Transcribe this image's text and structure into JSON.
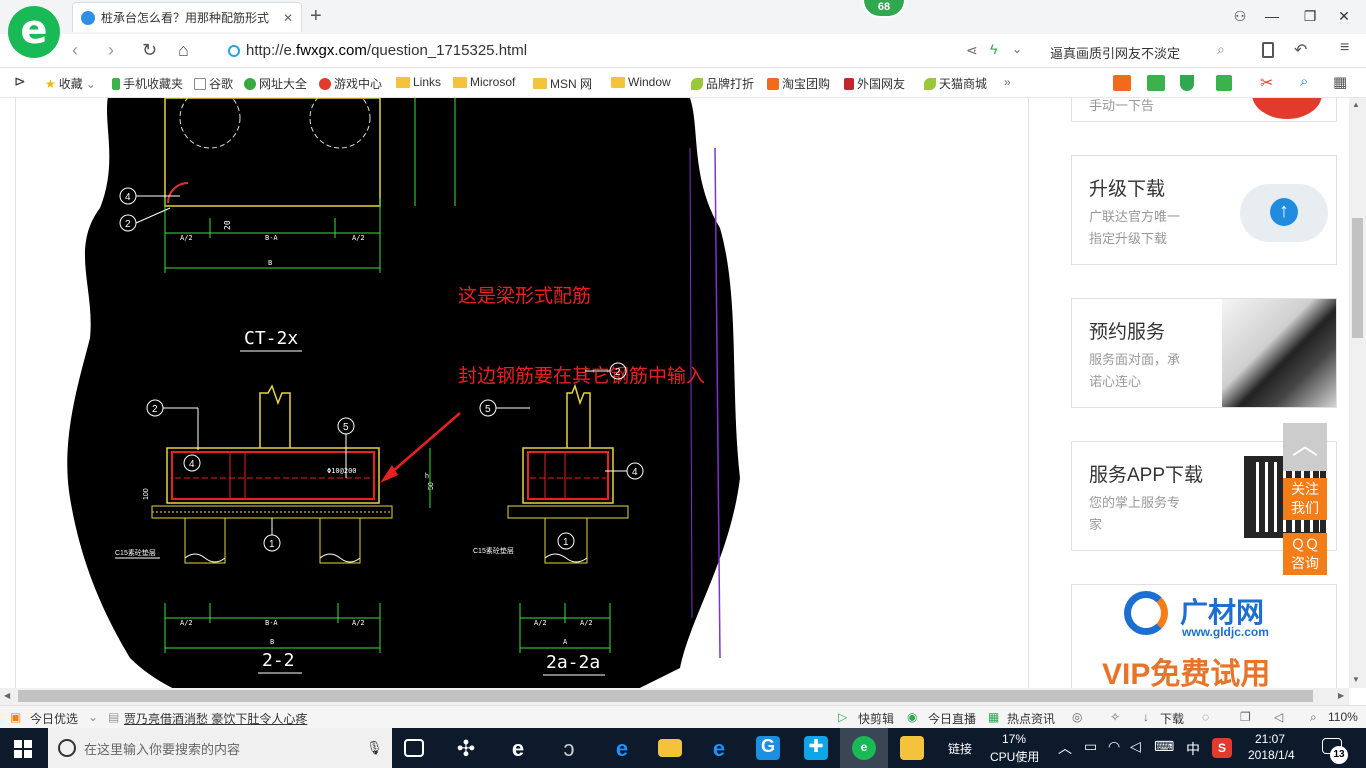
{
  "browser": {
    "badge_count": "68",
    "tab_title": "桩承台怎么看？用那种配筋形式",
    "url_prefix": "http://e.",
    "url_domain": "fwxgx.com",
    "url_path": "/question_1715325.html",
    "search_text": "逼真画质引网友不淡定"
  },
  "bookmarks": [
    {
      "label": "收藏",
      "type": "star"
    },
    {
      "label": "手机收藏夹",
      "type": "phone"
    },
    {
      "label": "谷歌",
      "type": "page"
    },
    {
      "label": "网址大全",
      "type": "site"
    },
    {
      "label": "游戏中心",
      "type": "game"
    },
    {
      "label": "Links",
      "type": "folder"
    },
    {
      "label": "Microsof",
      "type": "folder"
    },
    {
      "label": "MSN 网",
      "type": "folder"
    },
    {
      "label": "Window",
      "type": "folder"
    },
    {
      "label": "品牌打折",
      "type": "leaf"
    },
    {
      "label": "淘宝团购",
      "type": "taobao"
    },
    {
      "label": "外国网友",
      "type": "red"
    },
    {
      "label": "天猫商城",
      "type": "leaf"
    }
  ],
  "cad": {
    "annotation1": "这是梁形式配筋",
    "annotation2": "封边钢筋要在其它钢筋中输入",
    "view1": "CT-2x",
    "view2": "2-2",
    "view3": "2a-2a",
    "rebar_label": "Φ10@200",
    "cushion_left": "C15素砼垫层",
    "cushion_right": "C15素砼垫层",
    "dim_a2": "A/2",
    "dim_ba": "B-A",
    "dim_b": "B",
    "dim_a": "A",
    "dim_20": "20",
    "dim_100": "100",
    "dim_50": "50",
    "dim_h": "h",
    "callouts_left": [
      "2",
      "4",
      "5",
      "1"
    ],
    "callouts_right": [
      "5",
      "2",
      "4",
      "1"
    ],
    "callouts_top": [
      "4",
      "2"
    ]
  },
  "sidebar": {
    "top_partial": "手动一下告",
    "upgrade_title": "升级下载",
    "upgrade_sub1": "广联达官方唯一",
    "upgrade_sub2": "指定升级下载",
    "booking_title": "预约服务",
    "booking_sub1": "服务面对面，承",
    "booking_sub2": "诺心连心",
    "app_title": "服务APP下载",
    "app_sub1": "您的掌上服务专",
    "app_sub2": "家",
    "brand": "广材网",
    "brand_url": "www.gldjc.com",
    "vip": "VIP免费试用"
  },
  "float": {
    "follow1": "关注",
    "follow2": "我们",
    "qq1": "ＱＱ",
    "qq2": "咨询"
  },
  "statusbar": {
    "today": "今日优选",
    "news": "贾乃亮借酒消愁 豪饮下肚令人心疼",
    "quick": "快剪辑",
    "live": "今日直播",
    "hot": "热点资讯",
    "download": "下载",
    "zoom": "110%"
  },
  "taskbar": {
    "search_placeholder": "在这里输入你要搜索的内容",
    "links": "链接",
    "cpu_pct": "17%",
    "cpu_label": "CPU使用",
    "ime": "中",
    "time": "21:07",
    "date": "2018/1/4",
    "notif": "13"
  }
}
